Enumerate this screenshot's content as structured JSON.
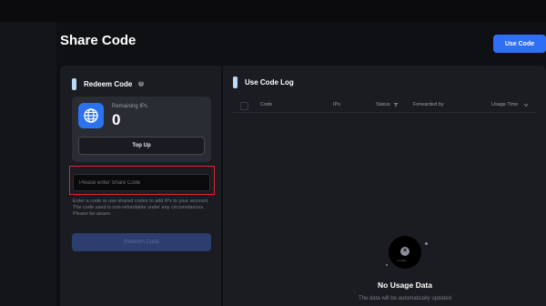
{
  "page": {
    "title": "Share Code"
  },
  "header": {
    "use_code_label": "Use Code"
  },
  "redeem": {
    "title": "Redeem Code",
    "remaining_label": "Remaining IPs",
    "remaining_value": "0",
    "topup_label": "Top Up",
    "input_placeholder": "Please enter Share Code",
    "input_value": "",
    "description": "Enter a code or use shared codes to add IPs to your account. The code used is non-refundable under any circumstances. Please be aware.",
    "redeem_label": "Redeem Code"
  },
  "log": {
    "title": "Use Code Log",
    "columns": [
      "Code",
      "IPs",
      "Status",
      "Forwarded by",
      "Usage Time"
    ],
    "empty_title": "No Usage Data",
    "empty_subtitle": "The data will be automatically updated"
  },
  "colors": {
    "accent": "#2f6ff5",
    "highlight": "#e0262a",
    "title_bar": "#b9daf7"
  },
  "icons": [
    "help-icon",
    "globe-icon",
    "filter-icon",
    "sort-icon",
    "empty-state-icon"
  ]
}
